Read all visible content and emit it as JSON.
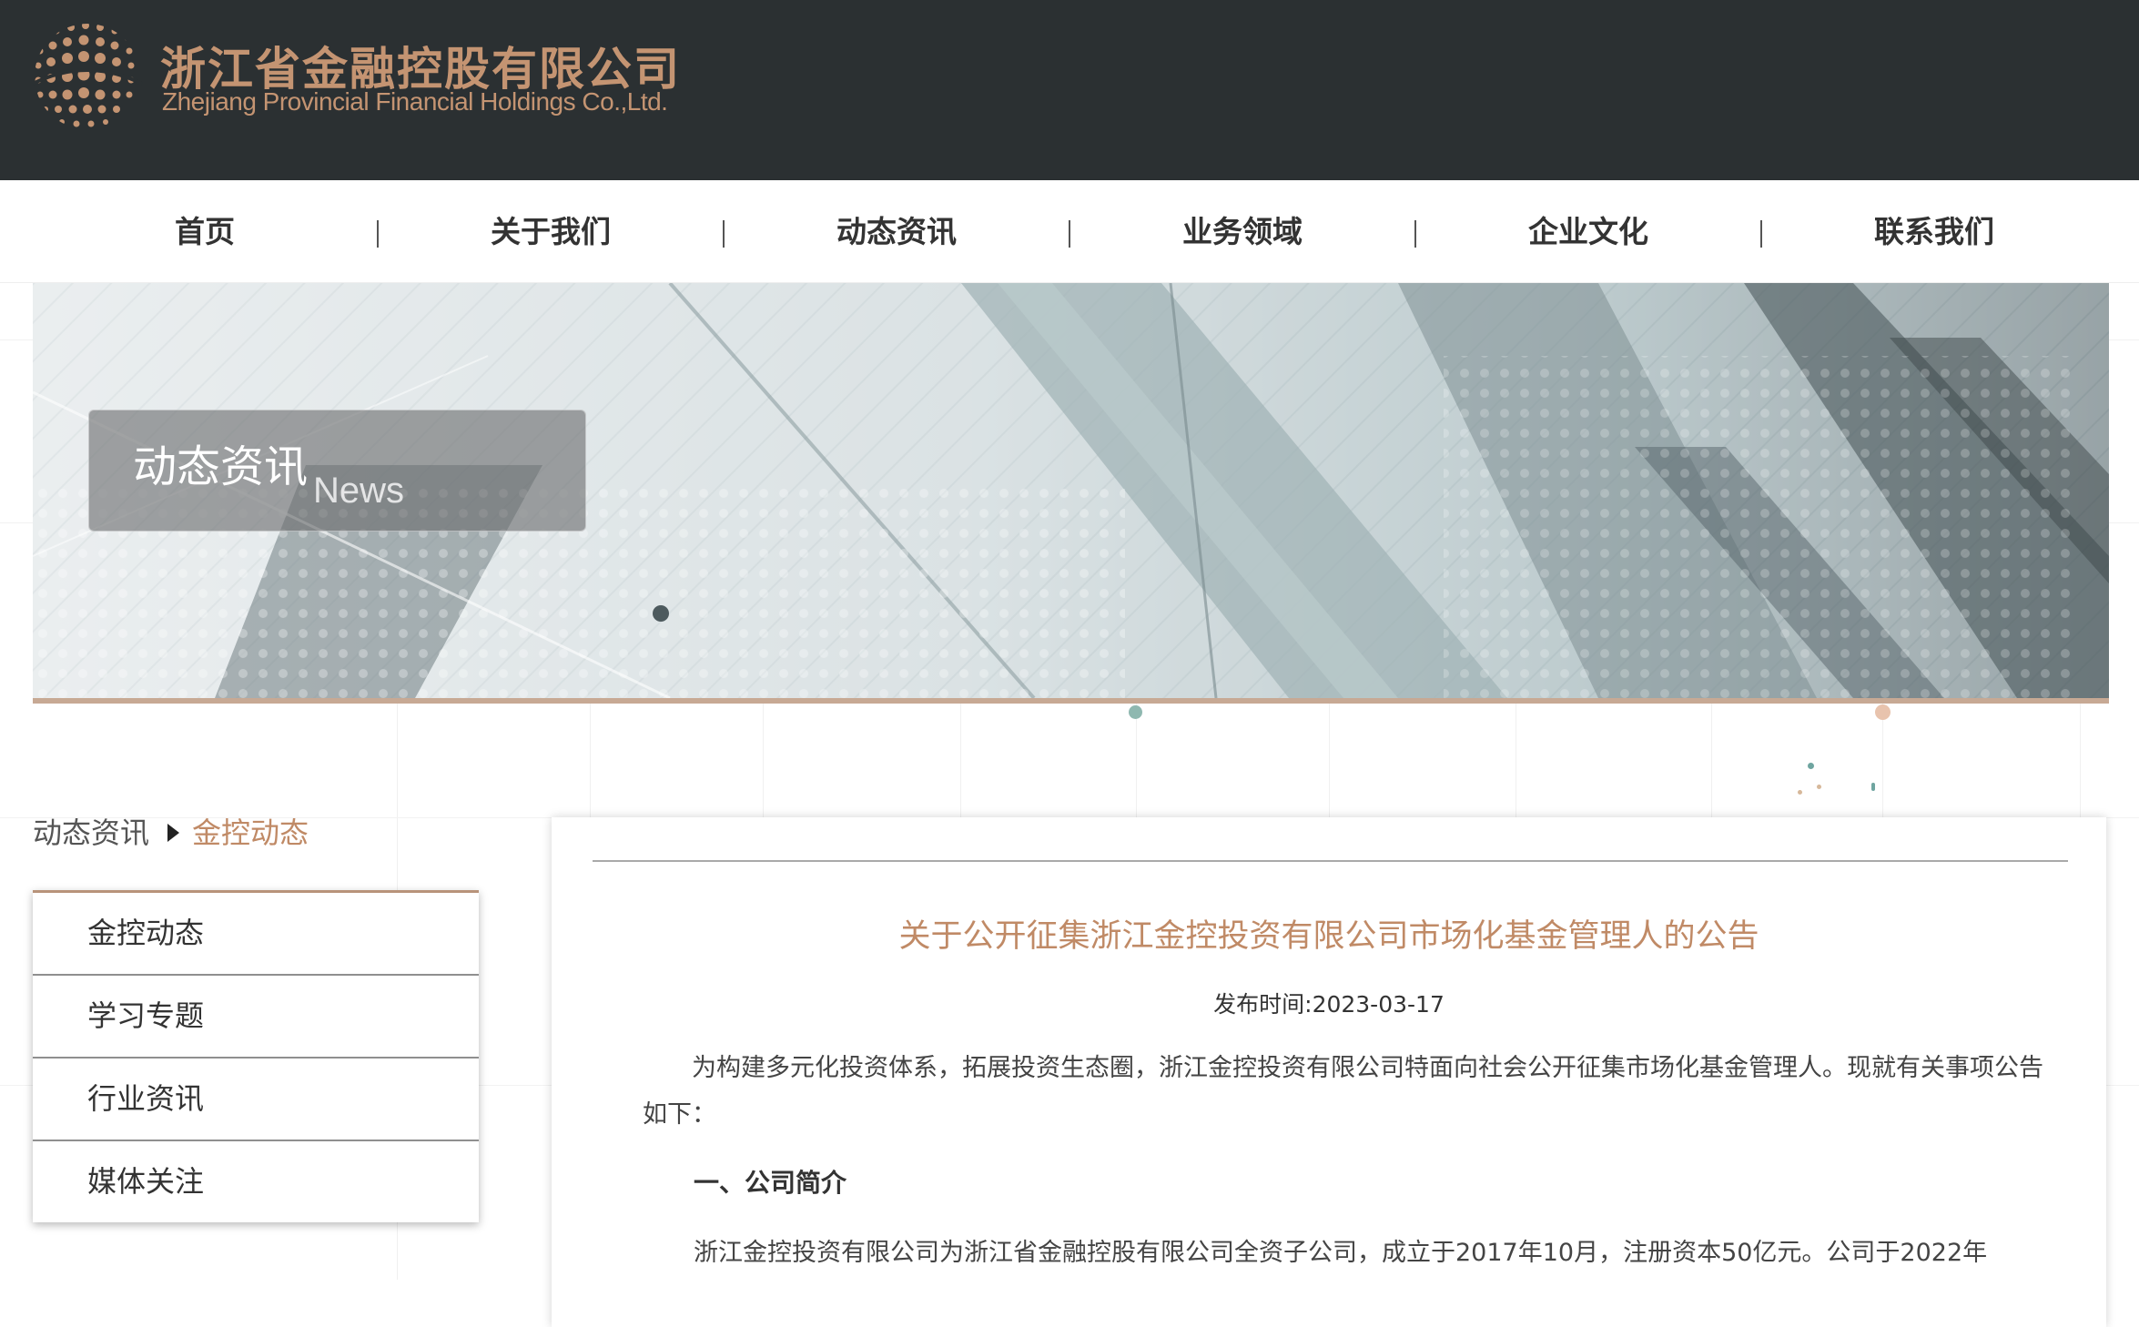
{
  "header": {
    "logo_cn": "浙江省金融控股有限公司",
    "logo_en": "Zhejiang Provincial Financial Holdings Co.,Ltd."
  },
  "nav": {
    "items": [
      {
        "label": "首页"
      },
      {
        "label": "关于我们"
      },
      {
        "label": "动态资讯"
      },
      {
        "label": "业务领域"
      },
      {
        "label": "企业文化"
      },
      {
        "label": "联系我们"
      }
    ]
  },
  "banner": {
    "title": "动态资讯",
    "subtitle": "News"
  },
  "breadcrumb": {
    "home": "动态资讯",
    "current": "金控动态"
  },
  "sidebar": {
    "items": [
      {
        "label": "金控动态"
      },
      {
        "label": "学习专题"
      },
      {
        "label": "行业资讯"
      },
      {
        "label": "媒体关注"
      }
    ]
  },
  "article": {
    "title": "关于公开征集浙江金控投资有限公司市场化基金管理人的公告",
    "publish_label": "发布时间:",
    "publish_date": "2023-03-17",
    "intro": "为构建多元化投资体系，拓展投资生态圈，浙江金控投资有限公司特面向社会公开征集市场化基金管理人。现就有关事项公告如下：",
    "section1_heading": "一、公司简介",
    "section1_text": "浙江金控投资有限公司为浙江省金融控股有限公司全资子公司，成立于2017年10月，注册资本50亿元。公司于2022年"
  },
  "colors": {
    "header_bg": "#2b3032",
    "brand_gold": "#c49472",
    "accent": "#c08a66"
  }
}
